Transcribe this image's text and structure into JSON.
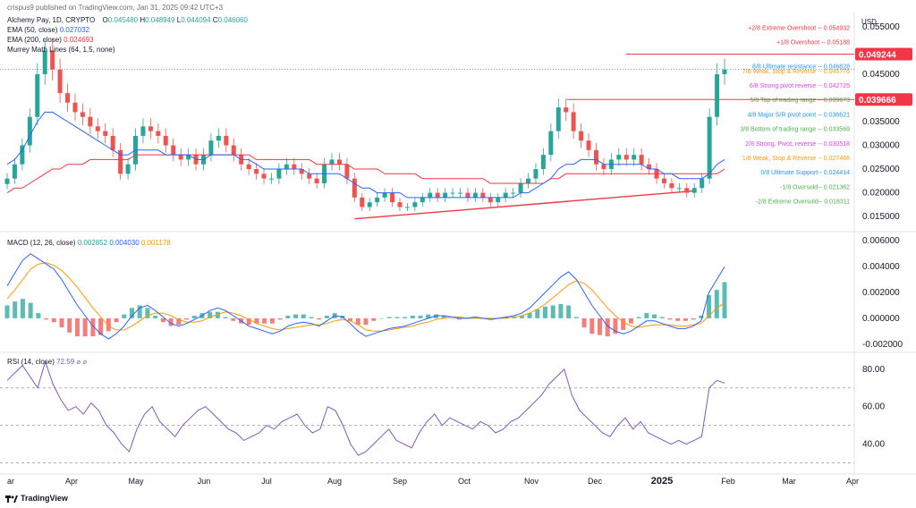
{
  "header": {
    "publisher": "crispus9 published on TradingView.com, Jan 31, 2025 09:42 UTC+3",
    "symbol": "Alchemy Pay, 1D, CRYPTO",
    "o_label": "O",
    "o": "0.045480",
    "h_label": "H",
    "h": "0.048949",
    "l_label": "L",
    "l": "0.044094",
    "c_label": "C",
    "c": "0.046060",
    "ema50_label": "EMA (50, close)",
    "ema50": "0.027032",
    "ema200_label": "EMA (200, close)",
    "ema200": "0.024693",
    "murrey_label": "Murrey Math Lines (64, 1.5, none)"
  },
  "currency": "USD",
  "colors": {
    "up": "#26a69a",
    "down": "#ef5350",
    "ema50": "#2962ff",
    "ema200": "#f23645",
    "macd": "#2962ff",
    "signal": "#ff9800",
    "rsi": "#7e57c2",
    "trend": "#f23645"
  },
  "footer": {
    "brand": "TradingView"
  },
  "chart_data": [
    {
      "type": "candlestick",
      "title": "Alchemy Pay, 1D, CRYPTO",
      "ylim": [
        0.012,
        0.058
      ],
      "y_ticks": [
        "0.055000",
        "0.045000",
        "0.035000",
        "0.030000",
        "0.025000",
        "0.020000",
        "0.015000"
      ],
      "y_tick_values": [
        0.055,
        0.045,
        0.035,
        0.03,
        0.025,
        0.02,
        0.015
      ],
      "x_labels": [
        "ar",
        "Apr",
        "May",
        "Jun",
        "Jul",
        "Aug",
        "Sep",
        "Oct",
        "Nov",
        "Dec",
        "2025",
        "Feb",
        "Mar",
        "Apr"
      ],
      "price_tags": [
        {
          "value": "0.049244",
          "y": 0.049244
        },
        {
          "value": "0.039666",
          "y": 0.039666
        }
      ],
      "murrey_levels": [
        {
          "label": "+2/8 Extreme Overshoot -- 0.054932",
          "y": 0.054932,
          "color": "#f23645"
        },
        {
          "label": "+1/8 Overshoot -- 0.05188",
          "y": 0.05188,
          "color": "#f23645"
        },
        {
          "label": "8/8 Ultimate resistance -- 0.046828",
          "y": 0.046828,
          "color": "#2196f3"
        },
        {
          "label": "7/8 Weak, Stop & Reverse -- 0.045776",
          "y": 0.045776,
          "color": "#ff9800"
        },
        {
          "label": "6/8 Strong pivot reverse -- 0.042725",
          "y": 0.042725,
          "color": "#e040fb"
        },
        {
          "label": "5/8 Top of trading range -- 0.039673",
          "y": 0.039673,
          "color": "#4caf50"
        },
        {
          "label": "4/8 Major S/R pivot point -- 0.036621",
          "y": 0.036621,
          "color": "#2196f3"
        },
        {
          "label": "3/8 Bottom of trading range -- 0.033569",
          "y": 0.033569,
          "color": "#4caf50"
        },
        {
          "label": "2/8 Strong, Pivot, reverse -- 0.030518",
          "y": 0.030518,
          "color": "#e040fb"
        },
        {
          "label": "1/8 Weak, Stop & Reverse -- 0.027466",
          "y": 0.027466,
          "color": "#ff9800"
        },
        {
          "label": "0/8 Ultimate Support-- 0.024414",
          "y": 0.024414,
          "color": "#2196f3"
        },
        {
          "label": "-1/8 Oversold-- 0.021362",
          "y": 0.021362,
          "color": "#4caf50"
        },
        {
          "label": "-2/8 Extreme Oversold-- 0.018311",
          "y": 0.018311,
          "color": "#4caf50"
        }
      ],
      "close": [
        0.023,
        0.026,
        0.03,
        0.036,
        0.045,
        0.05,
        0.046,
        0.041,
        0.039,
        0.037,
        0.036,
        0.034,
        0.033,
        0.032,
        0.029,
        0.024,
        0.026,
        0.032,
        0.034,
        0.033,
        0.032,
        0.03,
        0.028,
        0.027,
        0.028,
        0.026,
        0.028,
        0.031,
        0.032,
        0.03,
        0.028,
        0.026,
        0.025,
        0.024,
        0.023,
        0.023,
        0.025,
        0.026,
        0.025,
        0.024,
        0.023,
        0.022,
        0.026,
        0.027,
        0.026,
        0.023,
        0.019,
        0.017,
        0.018,
        0.019,
        0.02,
        0.018,
        0.017,
        0.017,
        0.018,
        0.019,
        0.02,
        0.019,
        0.02,
        0.02,
        0.02,
        0.019,
        0.02,
        0.019,
        0.018,
        0.019,
        0.02,
        0.02,
        0.022,
        0.023,
        0.025,
        0.028,
        0.033,
        0.038,
        0.037,
        0.033,
        0.031,
        0.029,
        0.026,
        0.025,
        0.027,
        0.028,
        0.027,
        0.028,
        0.026,
        0.025,
        0.023,
        0.022,
        0.021,
        0.021,
        0.02,
        0.021,
        0.023,
        0.036,
        0.045,
        0.046
      ],
      "ema50": [
        0.026,
        0.027,
        0.029,
        0.032,
        0.035,
        0.037,
        0.037,
        0.036,
        0.035,
        0.034,
        0.033,
        0.032,
        0.031,
        0.03,
        0.029,
        0.028,
        0.028,
        0.029,
        0.029,
        0.029,
        0.029,
        0.028,
        0.028,
        0.028,
        0.028,
        0.027,
        0.027,
        0.028,
        0.028,
        0.028,
        0.028,
        0.027,
        0.027,
        0.026,
        0.025,
        0.025,
        0.025,
        0.025,
        0.025,
        0.025,
        0.024,
        0.024,
        0.024,
        0.024,
        0.024,
        0.023,
        0.022,
        0.021,
        0.021,
        0.02,
        0.02,
        0.02,
        0.02,
        0.019,
        0.019,
        0.019,
        0.019,
        0.019,
        0.019,
        0.019,
        0.019,
        0.019,
        0.019,
        0.019,
        0.019,
        0.019,
        0.019,
        0.019,
        0.02,
        0.02,
        0.021,
        0.022,
        0.023,
        0.025,
        0.026,
        0.026,
        0.027,
        0.027,
        0.027,
        0.026,
        0.026,
        0.026,
        0.026,
        0.026,
        0.026,
        0.025,
        0.025,
        0.024,
        0.024,
        0.023,
        0.023,
        0.023,
        0.023,
        0.024,
        0.026,
        0.027
      ],
      "ema200": [
        0.02,
        0.021,
        0.021,
        0.022,
        0.023,
        0.024,
        0.025,
        0.025,
        0.026,
        0.026,
        0.026,
        0.027,
        0.027,
        0.027,
        0.027,
        0.027,
        0.027,
        0.028,
        0.028,
        0.028,
        0.028,
        0.028,
        0.028,
        0.028,
        0.028,
        0.028,
        0.028,
        0.028,
        0.028,
        0.028,
        0.028,
        0.028,
        0.028,
        0.027,
        0.027,
        0.027,
        0.027,
        0.027,
        0.027,
        0.027,
        0.027,
        0.026,
        0.026,
        0.026,
        0.026,
        0.026,
        0.025,
        0.025,
        0.025,
        0.025,
        0.024,
        0.024,
        0.024,
        0.024,
        0.024,
        0.023,
        0.023,
        0.023,
        0.023,
        0.023,
        0.023,
        0.023,
        0.023,
        0.023,
        0.022,
        0.022,
        0.022,
        0.022,
        0.022,
        0.022,
        0.022,
        0.022,
        0.023,
        0.023,
        0.024,
        0.024,
        0.024,
        0.024,
        0.024,
        0.024,
        0.024,
        0.024,
        0.024,
        0.024,
        0.024,
        0.024,
        0.024,
        0.024,
        0.024,
        0.024,
        0.024,
        0.024,
        0.024,
        0.024,
        0.024,
        0.025
      ]
    },
    {
      "type": "macd",
      "title": "MACD (12, 26, close)",
      "values": [
        "0.002852",
        "0.004030",
        "0.001178"
      ],
      "ylim": [
        -0.0025,
        0.0065
      ],
      "y_ticks": [
        "0.006000",
        "0.004000",
        "0.002000",
        "0.000000",
        "-0.002000"
      ],
      "y_tick_values": [
        0.006,
        0.004,
        0.002,
        0.0,
        -0.002
      ],
      "macd": [
        0.0025,
        0.0035,
        0.0045,
        0.005,
        0.0046,
        0.0042,
        0.0038,
        0.003,
        0.002,
        0.001,
        0.0002,
        -0.0006,
        -0.0012,
        -0.0016,
        -0.0012,
        -0.0006,
        0.0002,
        0.0008,
        0.001,
        0.0006,
        0.0001,
        -0.0004,
        -0.0006,
        -0.0004,
        -0.0001,
        0.0002,
        0.0006,
        0.0008,
        0.0006,
        0.0002,
        -0.0002,
        -0.0006,
        -0.0008,
        -0.001,
        -0.0012,
        -0.001,
        -0.0006,
        -0.0004,
        -0.0003,
        -0.0004,
        -0.0006,
        -0.0002,
        0.0002,
        0.0001,
        -0.0004,
        -0.001,
        -0.0014,
        -0.0012,
        -0.001,
        -0.0008,
        -0.0007,
        -0.0006,
        -0.0004,
        -0.0002,
        0.0,
        0.0002,
        0.0002,
        0.0001,
        0.0,
        0.0,
        0.0001,
        0.0,
        -0.0001,
        0.0,
        0.0001,
        0.0002,
        0.0004,
        0.0008,
        0.0014,
        0.002,
        0.0026,
        0.0032,
        0.0036,
        0.003,
        0.002,
        0.001,
        0.0002,
        -0.0006,
        -0.001,
        -0.0012,
        -0.001,
        -0.0006,
        -0.0002,
        -0.0002,
        -0.0004,
        -0.0006,
        -0.0008,
        -0.0008,
        -0.0006,
        -0.0002,
        0.002,
        0.003,
        0.004
      ],
      "signal": [
        0.0015,
        0.0022,
        0.003,
        0.0038,
        0.0042,
        0.0043,
        0.0041,
        0.0037,
        0.0031,
        0.0024,
        0.0016,
        0.0008,
        0.0001,
        -0.0006,
        -0.0009,
        -0.0009,
        -0.0006,
        -0.0002,
        0.0002,
        0.0004,
        0.0004,
        0.0002,
        -0.0001,
        -0.0003,
        -0.0003,
        -0.0002,
        0.0001,
        0.0003,
        0.0005,
        0.0004,
        0.0002,
        -0.0001,
        -0.0004,
        -0.0006,
        -0.0008,
        -0.0009,
        -0.0008,
        -0.0007,
        -0.0006,
        -0.0005,
        -0.0005,
        -0.0004,
        -0.0002,
        -0.0001,
        -0.0002,
        -0.0005,
        -0.0009,
        -0.001,
        -0.001,
        -0.0009,
        -0.0008,
        -0.0007,
        -0.0006,
        -0.0004,
        -0.0003,
        -0.0001,
        0.0,
        0.0001,
        0.0001,
        0.0,
        0.0,
        0.0,
        0.0,
        0.0,
        0.0,
        0.0001,
        0.0002,
        0.0004,
        0.0007,
        0.0011,
        0.0016,
        0.0021,
        0.0026,
        0.0029,
        0.0027,
        0.0022,
        0.0015,
        0.0008,
        0.0002,
        -0.0003,
        -0.0006,
        -0.0007,
        -0.0006,
        -0.0005,
        -0.0005,
        -0.0005,
        -0.0006,
        -0.0006,
        -0.0005,
        -0.0004,
        0.0002,
        0.0008,
        0.0012
      ]
    },
    {
      "type": "line",
      "title": "RSI (14, close)",
      "value": "72.59",
      "ylim": [
        25,
        88
      ],
      "y_ticks": [
        "80.00",
        "60.00",
        "40.00"
      ],
      "y_tick_values": [
        80,
        60,
        40
      ],
      "bands": [
        70,
        50,
        30
      ],
      "rsi": [
        74,
        78,
        82,
        76,
        70,
        84,
        72,
        64,
        58,
        60,
        56,
        62,
        58,
        50,
        46,
        40,
        36,
        48,
        56,
        60,
        52,
        48,
        44,
        50,
        54,
        58,
        60,
        56,
        52,
        48,
        46,
        42,
        44,
        46,
        50,
        48,
        52,
        54,
        56,
        50,
        46,
        48,
        60,
        58,
        50,
        40,
        34,
        36,
        40,
        44,
        48,
        42,
        40,
        38,
        46,
        52,
        56,
        50,
        54,
        52,
        50,
        48,
        52,
        50,
        46,
        48,
        52,
        54,
        58,
        62,
        66,
        72,
        76,
        80,
        66,
        58,
        54,
        50,
        46,
        44,
        50,
        54,
        48,
        52,
        46,
        44,
        42,
        40,
        42,
        40,
        42,
        44,
        70,
        74,
        72.6
      ]
    }
  ]
}
